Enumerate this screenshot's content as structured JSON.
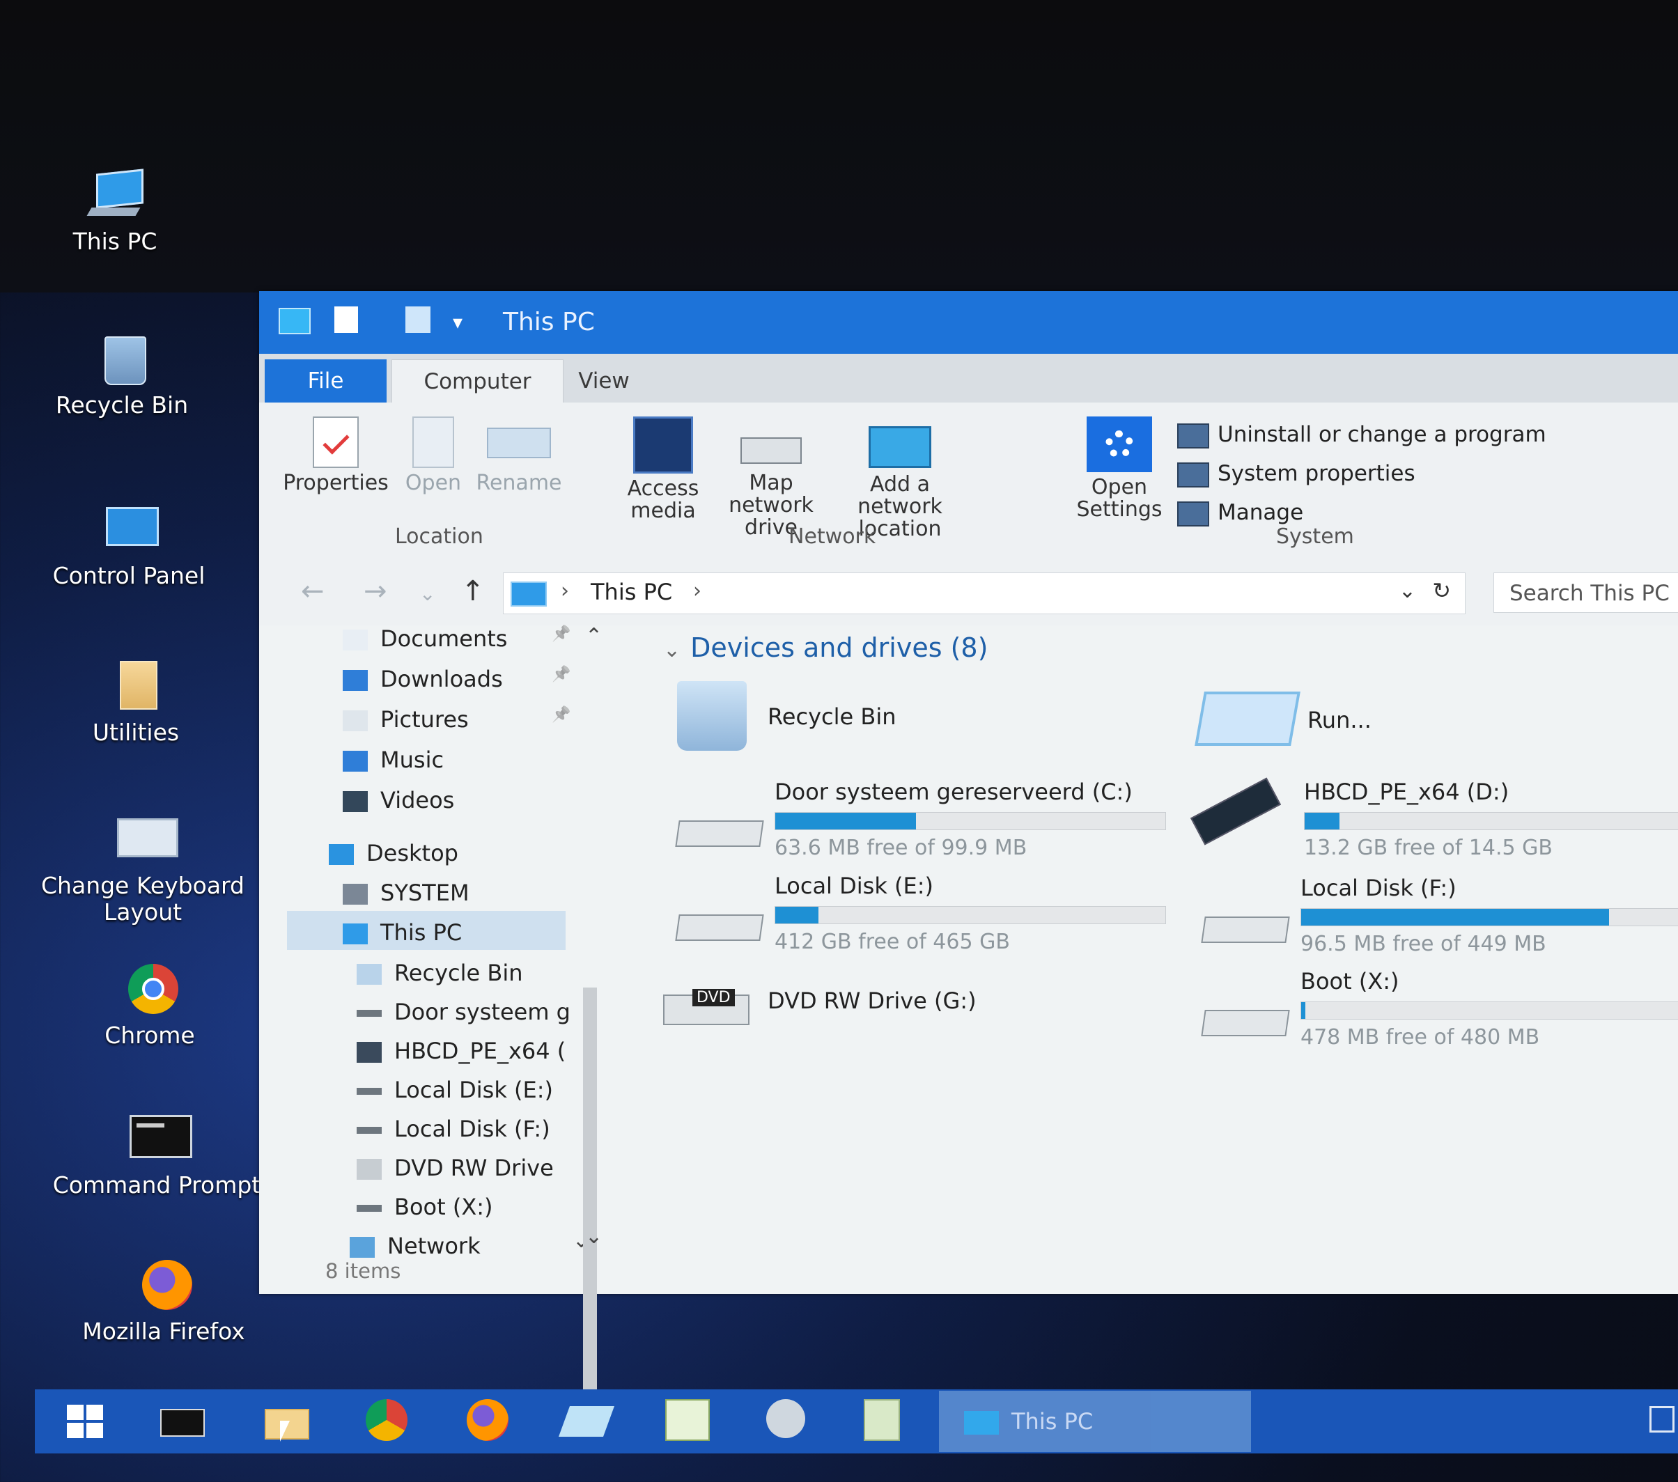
{
  "desktop": {
    "icons": [
      {
        "label": "This PC",
        "icon": "this-pc-icon"
      },
      {
        "label": "Recycle Bin",
        "icon": "recycle-bin-icon"
      },
      {
        "label": "Control Panel",
        "icon": "control-panel-icon"
      },
      {
        "label": "Utilities",
        "icon": "folder-icon"
      },
      {
        "label": "Change Keyboard Layout",
        "icon": "keyboard-icon"
      },
      {
        "label": "Chrome",
        "icon": "chrome-icon"
      },
      {
        "label": "Command Prompt",
        "icon": "cmd-icon"
      },
      {
        "label": "Mozilla Firefox",
        "icon": "firefox-icon"
      }
    ]
  },
  "window": {
    "title": "This PC",
    "tabs": {
      "file": "File",
      "computer": "Computer",
      "view": "View"
    },
    "ribbon": {
      "location": {
        "group": "Location",
        "properties": "Properties",
        "open": "Open",
        "rename": "Rename"
      },
      "network": {
        "group": "Network",
        "access_media": "Access media",
        "map_drive": "Map network drive",
        "add_location": "Add a network location"
      },
      "system": {
        "group": "System",
        "open_settings": "Open Settings",
        "uninstall": "Uninstall or change a program",
        "system_properties": "System properties",
        "manage": "Manage"
      }
    },
    "address": {
      "crumb": "This PC",
      "search_placeholder": "Search This PC"
    },
    "nav": {
      "items": [
        {
          "label": "Documents",
          "icon": "documents-icon",
          "pinned": true
        },
        {
          "label": "Downloads",
          "icon": "downloads-icon",
          "pinned": true
        },
        {
          "label": "Pictures",
          "icon": "pictures-icon",
          "pinned": true
        },
        {
          "label": "Music",
          "icon": "music-icon"
        },
        {
          "label": "Videos",
          "icon": "videos-icon"
        },
        {
          "label": "Desktop",
          "icon": "desktop-icon"
        },
        {
          "label": "SYSTEM",
          "icon": "user-icon"
        },
        {
          "label": "This PC",
          "icon": "this-pc-icon",
          "selected": true
        },
        {
          "label": "Recycle Bin",
          "icon": "recycle-bin-icon"
        },
        {
          "label": "Door systeem g",
          "icon": "drive-icon"
        },
        {
          "label": "HBCD_PE_x64 (",
          "icon": "usb-icon"
        },
        {
          "label": "Local Disk (E:)",
          "icon": "drive-icon"
        },
        {
          "label": "Local Disk (F:)",
          "icon": "drive-icon"
        },
        {
          "label": "DVD RW Drive",
          "icon": "dvd-icon"
        },
        {
          "label": "Boot (X:)",
          "icon": "drive-icon"
        },
        {
          "label": "Network",
          "icon": "network-icon"
        }
      ]
    },
    "content": {
      "section": "Devices and drives (8)",
      "items": [
        {
          "name": "Recycle Bin",
          "icon": "recycle-bin-icon"
        },
        {
          "name": "Run...",
          "icon": "run-icon"
        },
        {
          "name": "Door systeem gereserveerd (C:)",
          "free": "63.6 MB free of 99.9 MB",
          "used_fraction": 0.36
        },
        {
          "name": "HBCD_PE_x64 (D:)",
          "free": "13.2 GB free of 14.5 GB",
          "used_fraction": 0.09
        },
        {
          "name": "Local Disk (E:)",
          "free": "412 GB free of 465 GB",
          "used_fraction": 0.11
        },
        {
          "name": "Local Disk (F:)",
          "free": "96.5 MB free of 449 MB",
          "used_fraction": 0.79
        },
        {
          "name": "DVD RW Drive (G:)",
          "icon": "dvd-icon"
        },
        {
          "name": "Boot (X:)",
          "free": "478 MB free of 480 MB",
          "used_fraction": 0.01
        }
      ]
    },
    "status": "8 items"
  },
  "taskbar": {
    "active_label": "This PC",
    "apps": [
      "start-icon",
      "cmd-icon",
      "file-explorer-icon",
      "chrome-icon",
      "firefox-icon",
      "eraser-icon",
      "notepad-icon",
      "tools-icon",
      "calculator-icon"
    ]
  },
  "colors": {
    "accent": "#1d73d9",
    "drive_bar": "#1e90d4",
    "taskbar": "#1a56b8"
  }
}
